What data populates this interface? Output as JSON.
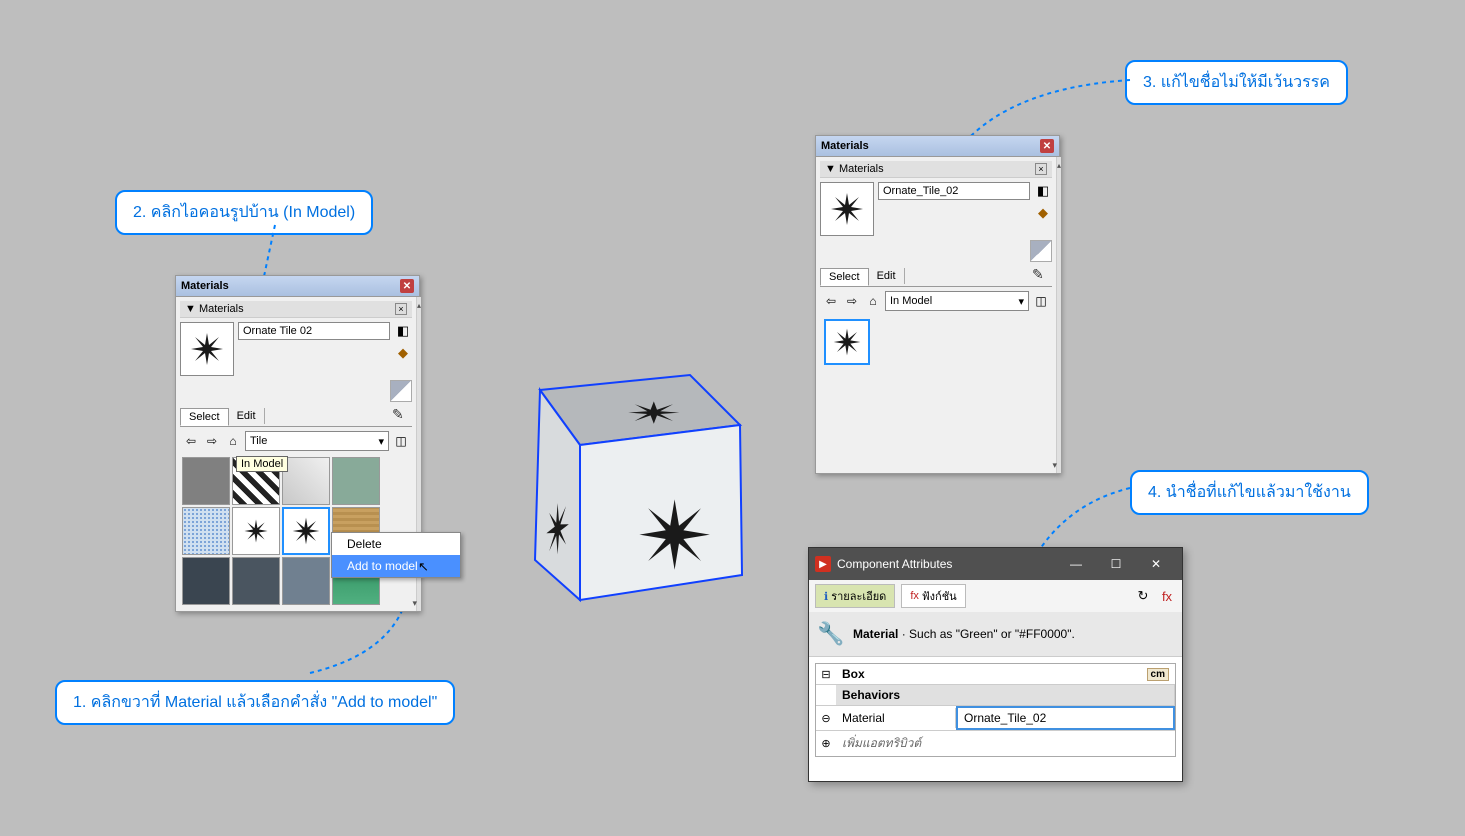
{
  "callout1": "1. คลิกขวาที่ Material แล้วเลือกคำสั่ง \"Add to model\"",
  "callout2": "2. คลิกไอคอนรูปบ้าน (In Model)",
  "callout3": "3. แก้ไขชื่อไม่ให้มีเว้นวรรค",
  "callout4": "4. นำชื่อที่แก้ไขแล้วมาใช้งาน",
  "panel1": {
    "title": "Materials",
    "subtitle": "Materials",
    "material_name": "Ornate Tile 02",
    "tab_select": "Select",
    "tab_edit": "Edit",
    "dropdown": "Tile",
    "tooltip": "In Model",
    "ctx_delete": "Delete",
    "ctx_add": "Add to model"
  },
  "panel2": {
    "title": "Materials",
    "subtitle": "Materials",
    "material_name": "Ornate_Tile_02",
    "tab_select": "Select",
    "tab_edit": "Edit",
    "dropdown": "In Model"
  },
  "comp": {
    "title": "Component Attributes",
    "tab1": "รายละเอียด",
    "tab2": "ฟังก์ชัน",
    "hint_bold": "Material",
    "hint_rest": " · Such as \"Green\" or \"#FF0000\".",
    "row_box": "Box",
    "unit": "cm",
    "row_behaviors": "Behaviors",
    "row_material": "Material",
    "row_material_val": "Ornate_Tile_02",
    "row_add": "เพิ่มแอตทริบิวต์"
  }
}
